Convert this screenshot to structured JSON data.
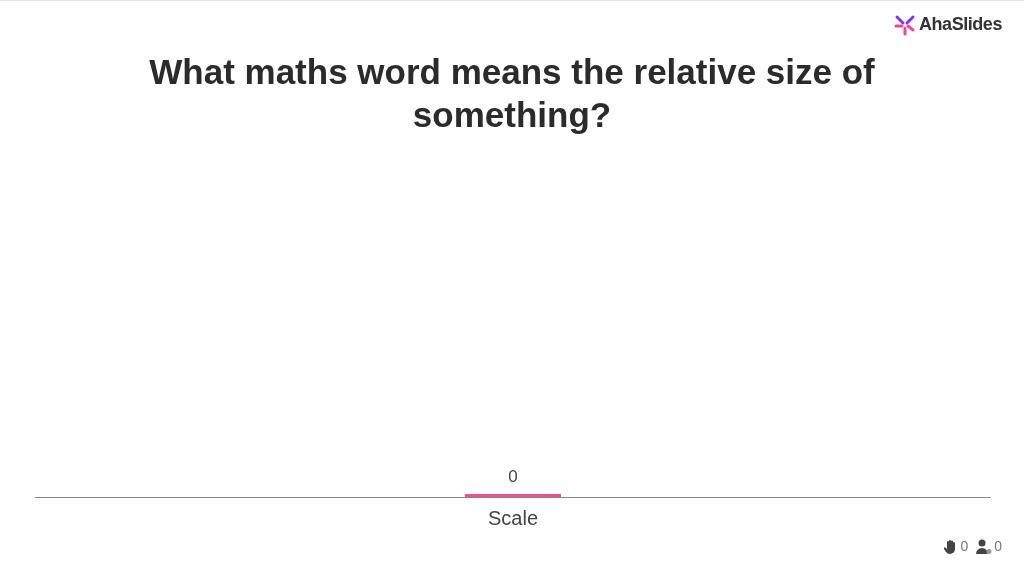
{
  "logo": {
    "text": "AhaSlides"
  },
  "question": "What maths word means the relative size of something?",
  "results": [
    {
      "label": "Scale",
      "count": "0"
    }
  ],
  "footer": {
    "reactions": "0",
    "participants": "0"
  }
}
